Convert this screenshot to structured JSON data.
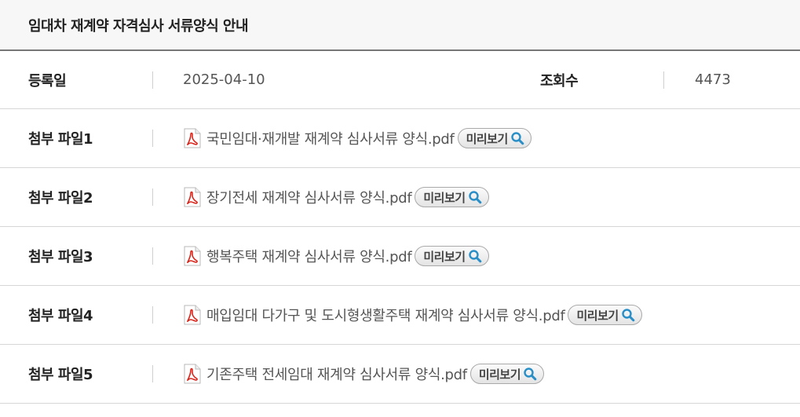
{
  "title": "임대차 재계약 자격심사 서류양식 안내",
  "meta": {
    "date_label": "등록일",
    "date_value": "2025-04-10",
    "views_label": "조회수",
    "views_value": "4473"
  },
  "attachments": [
    {
      "label": "첨부 파일1",
      "filename": "국민임대·재개발 재계약 심사서류 양식.pdf",
      "preview": "미리보기",
      "icon": "pdf-icon"
    },
    {
      "label": "첨부 파일2",
      "filename": "장기전세 재계약 심사서류 양식.pdf",
      "preview": "미리보기",
      "icon": "pdf-icon"
    },
    {
      "label": "첨부 파일3",
      "filename": "행복주택 재계약 심사서류 양식.pdf",
      "preview": "미리보기",
      "icon": "pdf-icon"
    },
    {
      "label": "첨부 파일4",
      "filename": "매입임대 다가구 및 도시형생활주택 재계약 심사서류 양식.pdf",
      "preview": "미리보기",
      "icon": "pdf-icon"
    },
    {
      "label": "첨부 파일5",
      "filename": "기존주택 전세임대 재계약 심사서류 양식.pdf",
      "preview": "미리보기",
      "icon": "pdf-icon"
    }
  ],
  "colors": {
    "pdf_red": "#d9261c",
    "search_blue": "#2a8fc7"
  }
}
